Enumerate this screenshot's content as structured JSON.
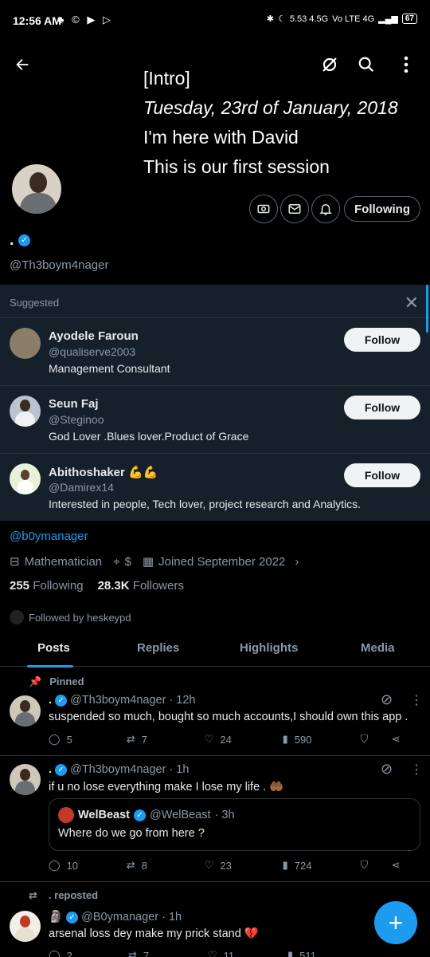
{
  "status_bar": {
    "time": "12:56 AM",
    "left_icons": "♣ © ▶ ▷",
    "network": "5.53 4.5G",
    "signal": "Vo LTE 4G",
    "battery": "67"
  },
  "header": {
    "intro_lines": [
      "[Intro]",
      "Tuesday, 23rd of January, 2018",
      "I'm here with David",
      "This is our first session"
    ]
  },
  "profile": {
    "display_name": ".",
    "handle": "@Th3boym4nager",
    "follow_button": "Following",
    "bio": "@b0ymanager",
    "category": "Mathematician",
    "location": "$",
    "joined": "Joined September 2022",
    "following_count": "255",
    "following_label": "Following",
    "followers_count": "28.3K",
    "followers_label": "Followers",
    "followed_by": "Followed by heskeypd"
  },
  "suggested": {
    "title": "Suggested",
    "users": [
      {
        "name": "Ayodele Faroun",
        "handle": "@qualiserve2003",
        "bio": "Management Consultant",
        "button": "Follow"
      },
      {
        "name": "Seun Faj",
        "handle": "@Steginoo",
        "bio": "God Lover .Blues lover.Product of Grace",
        "button": "Follow"
      },
      {
        "name": "Abithoshaker 💪💪",
        "handle": "@Damirex14",
        "bio": "Interested in people, Tech lover, project research and Analytics.",
        "button": "Follow"
      }
    ]
  },
  "tabs": [
    "Posts",
    "Replies",
    "Highlights",
    "Media"
  ],
  "posts": [
    {
      "label": "Pinned",
      "name": ".",
      "handle": "@Th3boym4nager",
      "time": "· 12h",
      "text": "suspended so much, bought so much accounts,I should own this app .",
      "replies": "5",
      "reposts": "7",
      "likes": "24",
      "views": "590"
    },
    {
      "name": ".",
      "handle": "@Th3boym4nager",
      "time": "· 1h",
      "text": "if u no lose everything make I lose my life . 🤲🏾",
      "quote_name": "WelBeast",
      "quote_handle": "@WelBeast",
      "quote_time": "· 3h",
      "quote_text": "Where do we go from here ?",
      "replies": "10",
      "reposts": "8",
      "likes": "23",
      "views": "724"
    },
    {
      "label": ". reposted",
      "name": "🗿",
      "handle": "@B0ymanager",
      "time": "· 1h",
      "text": "arsenal loss dey make my prick stand 💔",
      "replies": "2",
      "reposts": "7",
      "likes": "11",
      "views": "511"
    }
  ],
  "colors": {
    "accent": "#1d9bf0",
    "background": "#000000",
    "panel": "#15202b"
  }
}
